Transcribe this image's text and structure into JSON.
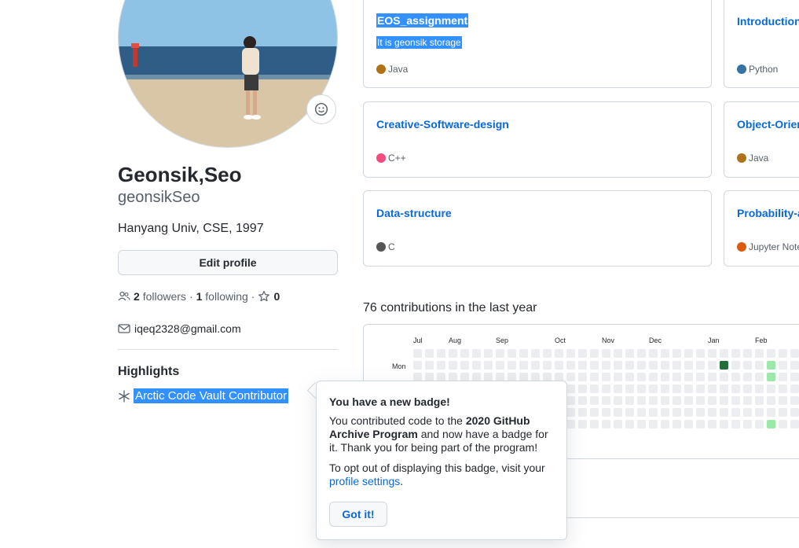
{
  "profile": {
    "full_name": "Geonsik,Seo",
    "username": "geonsikSeo",
    "bio": "Hanyang Univ, CSE, 1997",
    "edit_label": "Edit profile",
    "followers_count": "2",
    "followers_label": "followers",
    "sep1": "·",
    "following_count": "1",
    "following_label": "following",
    "sep2": "·",
    "stars_count": "0",
    "email": "iqeq2328@gmail.com",
    "highlights_title": "Highlights",
    "highlight_item": "Arctic Code Vault Contributor"
  },
  "repos": [
    {
      "name": "EOS_assignment",
      "description": "It is geonsik storage",
      "language": "Java",
      "color": "#b07219"
    },
    {
      "name": "Introduction",
      "language": "Python",
      "color": "#3572A5"
    },
    {
      "name": "Creative-Software-design",
      "language": "C++",
      "color": "#f34b7d"
    },
    {
      "name": "Object-Orier",
      "language": "Java",
      "color": "#b07219"
    },
    {
      "name": "Data-structure",
      "language": "C",
      "color": "#555555"
    },
    {
      "name": "Probability-a",
      "language": "Jupyter Note",
      "color": "#DA5B0B"
    }
  ],
  "contributions": {
    "title": "76 contributions in the last year",
    "months": [
      "Jul",
      "Aug",
      "Sep",
      "Oct",
      "Nov",
      "Dec",
      "Jan",
      "Feb"
    ],
    "day_label": "Mon",
    "colors": {
      "empty": "#ebedf0",
      "light": "#9be9a8",
      "dark": "#216e39"
    }
  },
  "popover": {
    "title": "You have a new badge!",
    "body_pre": "You contributed code to the ",
    "body_bold": "2020 GitHub Archive Program",
    "body_post": " and now have a badge for it. Thank you for being part of the program!",
    "optout_pre": "To opt out of displaying this badge, visit your ",
    "optout_link": "profile settings",
    "optout_post": ".",
    "button": "Got it!"
  },
  "icons": [
    "smiley-icon",
    "people-icon",
    "star-icon",
    "mail-icon",
    "snowflake-icon"
  ]
}
